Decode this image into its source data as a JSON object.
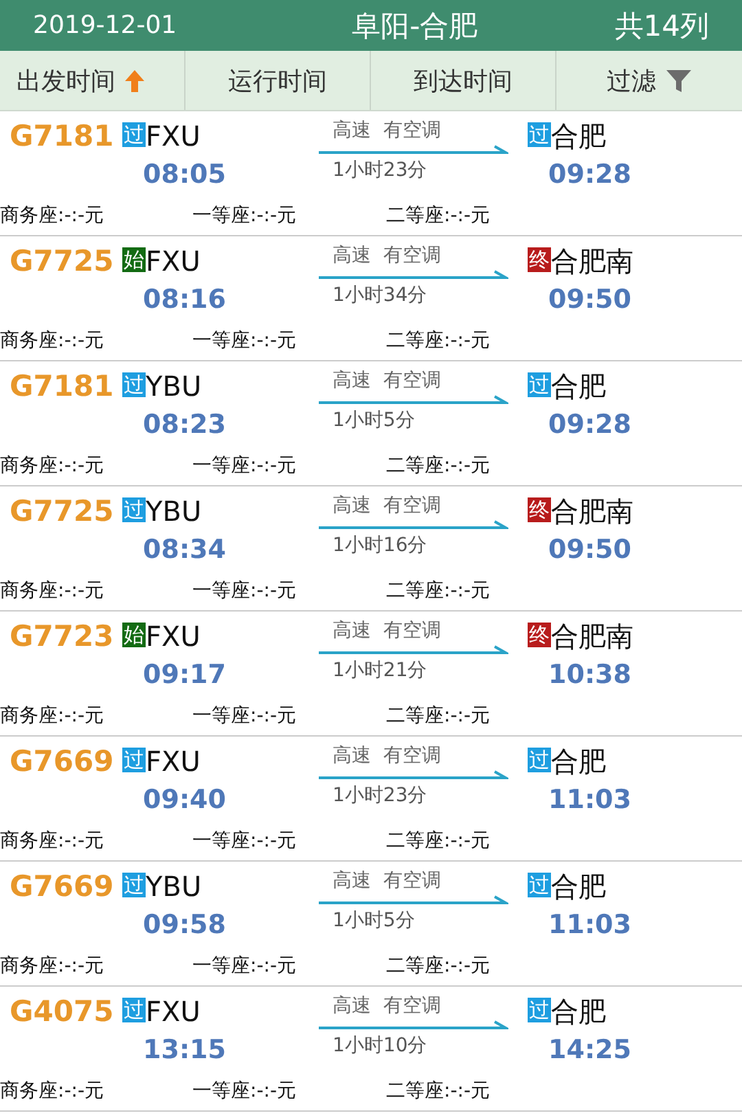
{
  "header": {
    "date": "2019-12-01",
    "route": "阜阳-合肥",
    "count": "共14列"
  },
  "sort_tabs": [
    {
      "label": "出发时间"
    },
    {
      "label": "运行时间"
    },
    {
      "label": "到达时间"
    },
    {
      "label": "过滤"
    }
  ],
  "trains": [
    {
      "number": "G7181",
      "from_badge": {
        "text": "过",
        "kind": "pass"
      },
      "from": "FXU",
      "depart": "08:05",
      "info": "高速  有空调",
      "duration": "1小时23分",
      "to_badge": {
        "text": "过",
        "kind": "pass"
      },
      "to": "合肥",
      "arrive": "09:28",
      "seats": [
        "商务座:-:-元",
        "一等座:-:-元",
        "二等座:-:-元"
      ]
    },
    {
      "number": "G7725",
      "from_badge": {
        "text": "始",
        "kind": "start"
      },
      "from": "FXU",
      "depart": "08:16",
      "info": "高速  有空调",
      "duration": "1小时34分",
      "to_badge": {
        "text": "终",
        "kind": "end"
      },
      "to": "合肥南",
      "arrive": "09:50",
      "seats": [
        "商务座:-:-元",
        "一等座:-:-元",
        "二等座:-:-元"
      ]
    },
    {
      "number": "G7181",
      "from_badge": {
        "text": "过",
        "kind": "pass"
      },
      "from": "YBU",
      "depart": "08:23",
      "info": "高速  有空调",
      "duration": "1小时5分",
      "to_badge": {
        "text": "过",
        "kind": "pass"
      },
      "to": "合肥",
      "arrive": "09:28",
      "seats": [
        "商务座:-:-元",
        "一等座:-:-元",
        "二等座:-:-元"
      ]
    },
    {
      "number": "G7725",
      "from_badge": {
        "text": "过",
        "kind": "pass"
      },
      "from": "YBU",
      "depart": "08:34",
      "info": "高速  有空调",
      "duration": "1小时16分",
      "to_badge": {
        "text": "终",
        "kind": "end"
      },
      "to": "合肥南",
      "arrive": "09:50",
      "seats": [
        "商务座:-:-元",
        "一等座:-:-元",
        "二等座:-:-元"
      ]
    },
    {
      "number": "G7723",
      "from_badge": {
        "text": "始",
        "kind": "start"
      },
      "from": "FXU",
      "depart": "09:17",
      "info": "高速  有空调",
      "duration": "1小时21分",
      "to_badge": {
        "text": "终",
        "kind": "end"
      },
      "to": "合肥南",
      "arrive": "10:38",
      "seats": [
        "商务座:-:-元",
        "一等座:-:-元",
        "二等座:-:-元"
      ]
    },
    {
      "number": "G7669",
      "from_badge": {
        "text": "过",
        "kind": "pass"
      },
      "from": "FXU",
      "depart": "09:40",
      "info": "高速  有空调",
      "duration": "1小时23分",
      "to_badge": {
        "text": "过",
        "kind": "pass"
      },
      "to": "合肥",
      "arrive": "11:03",
      "seats": [
        "商务座:-:-元",
        "一等座:-:-元",
        "二等座:-:-元"
      ]
    },
    {
      "number": "G7669",
      "from_badge": {
        "text": "过",
        "kind": "pass"
      },
      "from": "YBU",
      "depart": "09:58",
      "info": "高速  有空调",
      "duration": "1小时5分",
      "to_badge": {
        "text": "过",
        "kind": "pass"
      },
      "to": "合肥",
      "arrive": "11:03",
      "seats": [
        "商务座:-:-元",
        "一等座:-:-元",
        "二等座:-:-元"
      ]
    },
    {
      "number": "G4075",
      "from_badge": {
        "text": "过",
        "kind": "pass"
      },
      "from": "FXU",
      "depart": "13:15",
      "info": "高速  有空调",
      "duration": "1小时10分",
      "to_badge": {
        "text": "过",
        "kind": "pass"
      },
      "to": "合肥",
      "arrive": "14:25",
      "seats": [
        "商务座:-:-元",
        "一等座:-:-元",
        "二等座:-:-元"
      ]
    }
  ]
}
